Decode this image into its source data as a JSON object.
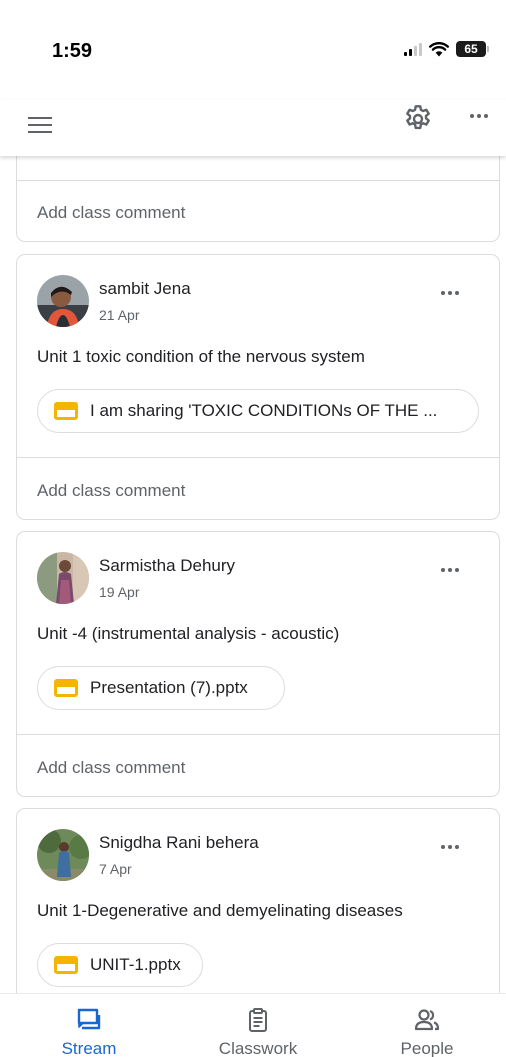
{
  "status_bar": {
    "time": "1:59",
    "battery": "65"
  },
  "colors": {
    "accent": "#1967d2",
    "attachment": "#f4b400",
    "secondary_text": "#5f6368",
    "border": "#dadce0"
  },
  "app_bar": {
    "menu_icon": "hamburger-menu-icon",
    "settings_icon": "gear-icon",
    "more_icon": "more-horiz-icon"
  },
  "feed": {
    "top_partial": {
      "comment_placeholder": "Add class comment"
    },
    "posts": [
      {
        "author": "sambit Jena",
        "date": "21 Apr",
        "text": "Unit 1 toxic condition of the nervous system",
        "attachment": "I am sharing 'TOXIC CONDITIONs OF THE ...",
        "comment_placeholder": "Add class comment"
      },
      {
        "author": "Sarmistha Dehury",
        "date": "19 Apr",
        "text": "Unit -4 (instrumental analysis - acoustic)",
        "attachment": "Presentation (7).pptx",
        "comment_placeholder": "Add class comment"
      },
      {
        "author": "Snigdha Rani behera",
        "date": "7 Apr",
        "text": "Unit 1-Degenerative and demyelinating diseases",
        "attachment": "UNIT-1.pptx"
      }
    ]
  },
  "bottom_nav": {
    "items": [
      {
        "label": "Stream",
        "icon": "stream-icon",
        "active": true
      },
      {
        "label": "Classwork",
        "icon": "classwork-icon",
        "active": false
      },
      {
        "label": "People",
        "icon": "people-icon",
        "active": false
      }
    ]
  }
}
